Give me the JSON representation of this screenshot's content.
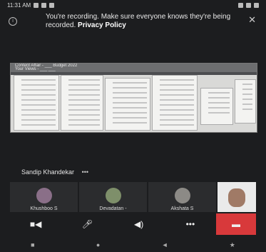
{
  "status": {
    "time": "11:31 AM",
    "icons_left": [
      "notification-icon",
      "video-icon",
      "gear-icon",
      "check-icon"
    ],
    "icons_right": [
      "wifi-icon",
      "signal-icon",
      "battery-icon"
    ]
  },
  "banner": {
    "text": "You're recording. Make sure everyone knows they're being recorded. ",
    "link": "Privacy Policy"
  },
  "share": {
    "title": "Content Affair - ___ Budget 2022",
    "subtitle": "Your Views - ___ ___"
  },
  "speaker": {
    "name": "Sandip Khandekar",
    "more": "•••"
  },
  "participants": [
    {
      "name": "Khushboo S"
    },
    {
      "name": "Devadatan - "
    },
    {
      "name": "Akshata S"
    },
    {
      "name": ""
    }
  ],
  "controls": [
    "camera",
    "mic",
    "speaker",
    "more",
    "end-call"
  ],
  "nav": {
    "back": "■",
    "home": "●",
    "recent": "◄",
    "extra": "★"
  }
}
